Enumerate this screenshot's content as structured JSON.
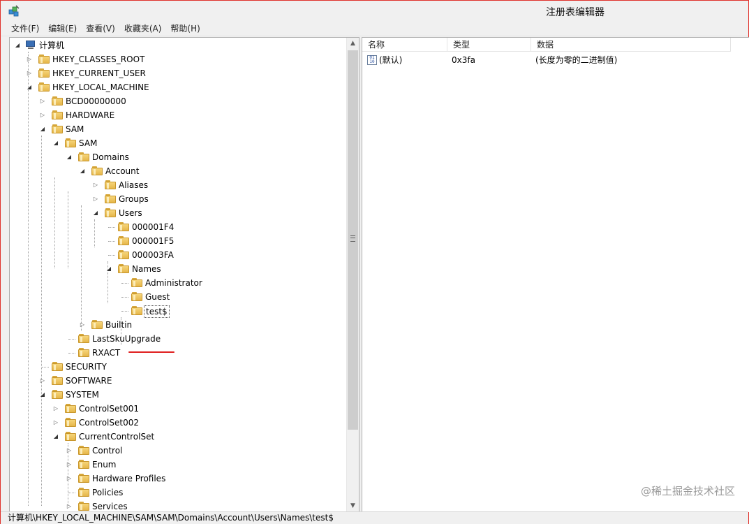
{
  "window": {
    "title": "注册表编辑器"
  },
  "menu": [
    "文件(F)",
    "编辑(E)",
    "查看(V)",
    "收藏夹(A)",
    "帮助(H)"
  ],
  "tree": {
    "root": "计算机",
    "nodes": [
      "HKEY_CLASSES_ROOT",
      "HKEY_CURRENT_USER",
      "HKEY_LOCAL_MACHINE",
      "BCD00000000",
      "HARDWARE",
      "SAM",
      "SAM",
      "Domains",
      "Account",
      "Aliases",
      "Groups",
      "Users",
      "000001F4",
      "000001F5",
      "000003FA",
      "Names",
      "Administrator",
      "Guest",
      "test$",
      "Builtin",
      "LastSkuUpgrade",
      "RXACT",
      "SECURITY",
      "SOFTWARE",
      "SYSTEM",
      "ControlSet001",
      "ControlSet002",
      "CurrentControlSet",
      "Control",
      "Enum",
      "Hardware Profiles",
      "Policies",
      "Services"
    ]
  },
  "values": {
    "columns": [
      "名称",
      "类型",
      "数据"
    ],
    "rows": [
      {
        "name": "(默认)",
        "type": "0x3fa",
        "data": "(长度为零的二进制值)"
      }
    ]
  },
  "status": {
    "path": "计算机\\HKEY_LOCAL_MACHINE\\SAM\\SAM\\Domains\\Account\\Users\\Names\\test$"
  },
  "watermark": "@稀土掘金技术社区",
  "icons": {
    "app": "registry-editor-icon",
    "folder": "folder-icon",
    "computer": "computer-icon",
    "value": "binary-value-icon"
  },
  "colors": {
    "highlight_underline": "#e02020",
    "window_border": "#e0312a"
  }
}
